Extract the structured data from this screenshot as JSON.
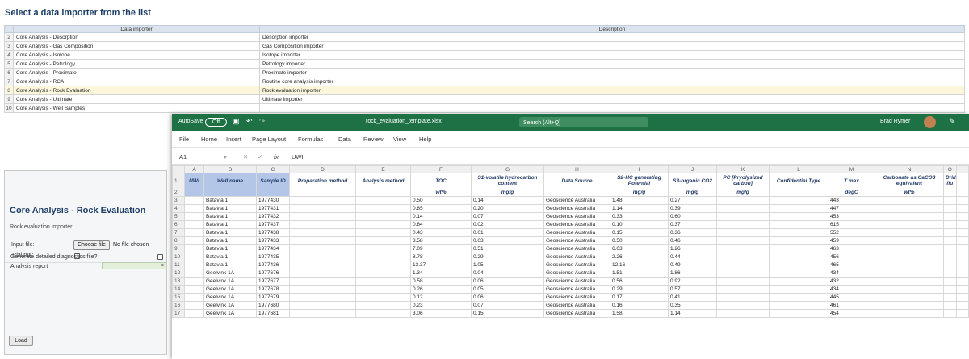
{
  "page_title": "Select a data importer from the list",
  "importer_table": {
    "headers": [
      "Data importer",
      "Description"
    ],
    "rows": [
      {
        "num": "2",
        "name": "Core Analysis - Desorption",
        "desc": "Desorption importer"
      },
      {
        "num": "3",
        "name": "Core Analysis - Gas Composition",
        "desc": "Gas Composition importer"
      },
      {
        "num": "4",
        "name": "Core Analysis - Isotope",
        "desc": "Isotope importer"
      },
      {
        "num": "5",
        "name": "Core Analysis - Petrology",
        "desc": "Petrology importer"
      },
      {
        "num": "6",
        "name": "Core Analysis - Proximate",
        "desc": "Proximate importer"
      },
      {
        "num": "7",
        "name": "Core Analysis - RCA",
        "desc": "Routine core analysis importer"
      },
      {
        "num": "8",
        "name": "Core Analysis - Rock Evaluation",
        "desc": "Rock evaluation importer",
        "selected": true
      },
      {
        "num": "9",
        "name": "Core Analysis - Ultimate",
        "desc": "Ultimate importer"
      },
      {
        "num": "10",
        "name": "Core Analysis - Well Samples",
        "desc": ""
      }
    ]
  },
  "panel": {
    "title": "Core Analysis - Rock Evaluation",
    "subtitle": "Rock evaluation importer",
    "input_file_label": "Input file:",
    "choose_file": "Choose file",
    "no_file": "No file chosen",
    "trial_run": "Trial run:",
    "diagnostics": "Generate detailed diagnostics file?",
    "analysis_report": "Analysis report",
    "report_clear": "×",
    "load": "Load"
  },
  "excel": {
    "autosave": "AutoSave",
    "autosave_state": "Off",
    "filename": "rock_evaluation_template.xlsx",
    "search": "Search (Alt+Q)",
    "user": "Brad Rymer",
    "menu": [
      "File",
      "Home",
      "Insert",
      "Page Layout",
      "Formulas",
      "Data",
      "Review",
      "View",
      "Help"
    ],
    "name_box": "A1",
    "formula_fx": "fx",
    "formula": "UWI",
    "column_letters": [
      "A",
      "B",
      "C",
      "D",
      "E",
      "F",
      "G",
      "H",
      "I",
      "J",
      "K",
      "L",
      "M",
      "N",
      "O"
    ],
    "header_row1": [
      "UWI",
      "Well name",
      "Sample ID",
      "Preparation method",
      "Analysis method",
      "TOC",
      "S1-volatile hydrocarbon content",
      "Data Source",
      "S2-HC generating Potential",
      "S3-organic CO2",
      "PC [Pryolysized carbon]",
      "Confidential Type",
      "T max",
      "Carbonate as CaCO3 equivalent",
      "Drilling flu"
    ],
    "header_row2": [
      "",
      "",
      "",
      "",
      "",
      "wt%",
      "mg/g",
      "",
      "mg/g",
      "mg/g",
      "mg/g",
      "",
      "degC",
      "wt%",
      ""
    ],
    "rows": [
      {
        "r": "3",
        "well": "Batavia 1",
        "id": "1977430",
        "toc": "0.50",
        "s1": "0.14",
        "src": "Geoscience Australia",
        "s2": "1.48",
        "s3": "0.27",
        "tmax": "443"
      },
      {
        "r": "4",
        "well": "Batavia 1",
        "id": "1977431",
        "toc": "0.85",
        "s1": "0.20",
        "src": "Geoscience Australia",
        "s2": "1.14",
        "s3": "0.39",
        "tmax": "447"
      },
      {
        "r": "5",
        "well": "Batavia 1",
        "id": "1977432",
        "toc": "0.14",
        "s1": "0.07",
        "src": "Geoscience Australia",
        "s2": "0.33",
        "s3": "0.60",
        "tmax": "453"
      },
      {
        "r": "6",
        "well": "Batavia 1",
        "id": "1977437",
        "toc": "0.84",
        "s1": "0.02",
        "src": "Geoscience Australia",
        "s2": "0.10",
        "s3": "0.37",
        "tmax": "615"
      },
      {
        "r": "7",
        "well": "Batavia 1",
        "id": "1977438",
        "toc": "0.43",
        "s1": "0.01",
        "src": "Geoscience Australia",
        "s2": "0.15",
        "s3": "0.36",
        "tmax": "552"
      },
      {
        "r": "8",
        "well": "Batavia 1",
        "id": "1977433",
        "toc": "3.58",
        "s1": "0.03",
        "src": "Geoscience Australia",
        "s2": "0.50",
        "s3": "0.46",
        "tmax": "459"
      },
      {
        "r": "9",
        "well": "Batavia 1",
        "id": "1977434",
        "toc": "7.09",
        "s1": "0.51",
        "src": "Geoscience Australia",
        "s2": "6.03",
        "s3": "1.26",
        "tmax": "463"
      },
      {
        "r": "10",
        "well": "Batavia 1",
        "id": "1977435",
        "toc": "8.78",
        "s1": "0.29",
        "src": "Geoscience Australia",
        "s2": "2.26",
        "s3": "0.44",
        "tmax": "456"
      },
      {
        "r": "11",
        "well": "Batavia 1",
        "id": "1977436",
        "toc": "13.37",
        "s1": "1.05",
        "src": "Geoscience Australia",
        "s2": "12.16",
        "s3": "0.49",
        "tmax": "465"
      },
      {
        "r": "12",
        "well": "Geelvink 1A",
        "id": "1977676",
        "toc": "1.34",
        "s1": "0.04",
        "src": "Geoscience Australia",
        "s2": "1.51",
        "s3": "1.86",
        "tmax": "434"
      },
      {
        "r": "13",
        "well": "Geelvink 1A",
        "id": "1977677",
        "toc": "0.58",
        "s1": "0.06",
        "src": "Geoscience Australia",
        "s2": "0.56",
        "s3": "0.92",
        "tmax": "432"
      },
      {
        "r": "14",
        "well": "Geelvink 1A",
        "id": "1977678",
        "toc": "0.26",
        "s1": "0.05",
        "src": "Geoscience Australia",
        "s2": "0.29",
        "s3": "0.57",
        "tmax": "434"
      },
      {
        "r": "15",
        "well": "Geelvink 1A",
        "id": "1977679",
        "toc": "0.12",
        "s1": "0.06",
        "src": "Geoscience Australia",
        "s2": "0.17",
        "s3": "0.41",
        "tmax": "445"
      },
      {
        "r": "16",
        "well": "Geelvink 1A",
        "id": "1977680",
        "toc": "0.23",
        "s1": "0.07",
        "src": "Geoscience Australia",
        "s2": "0.16",
        "s3": "0.35",
        "tmax": "461"
      },
      {
        "r": "17",
        "well": "Geelvink 1A",
        "id": "1977681",
        "toc": "3.06",
        "s1": "0.15",
        "src": "Geoscience Australia",
        "s2": "1.58",
        "s3": "1.14",
        "tmax": "454"
      }
    ]
  }
}
